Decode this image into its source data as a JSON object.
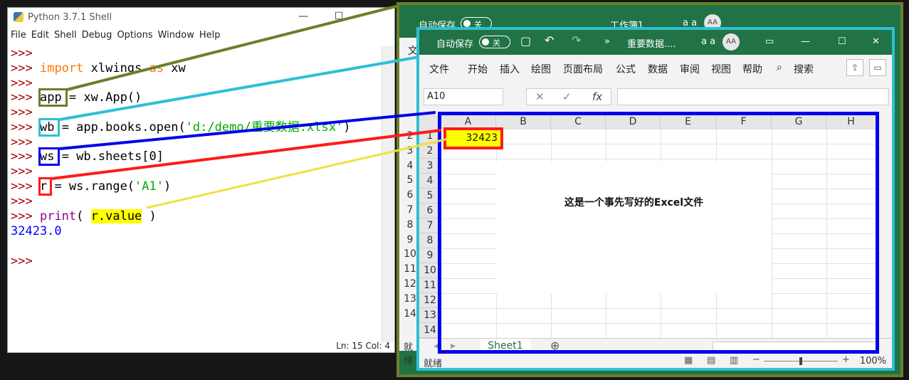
{
  "idle": {
    "title": "Python 3.7.1 Shell",
    "menu": [
      "File",
      "Edit",
      "Shell",
      "Debug",
      "Options",
      "Window",
      "Help"
    ],
    "prompt": ">>>",
    "lines": {
      "l2_kw": "import",
      "l2_rest": " xlwings ",
      "l2_as": "as",
      "l2_alias": " xw",
      "l4_var": "app",
      "l4_rest": " = xw.App()",
      "l6_var": "wb",
      "l6_rest": " = app.books.open(",
      "l6_str": "'d:/demo/重要数据.xlsx'",
      "l6_end": ")",
      "l8_var": "ws",
      "l8_rest": " = wb.sheets[0]",
      "l10_var": "r",
      "l10_rest": " = ws.range(",
      "l10_str": "'A1'",
      "l10_end": ")",
      "l12_fn": "print",
      "l12_open": "( ",
      "l12_arg": "r.value",
      "l12_close": " )",
      "output": "32423.0"
    },
    "status": "Ln: 15  Col: 4",
    "win_min": "—",
    "win_max": "☐"
  },
  "excel_back": {
    "autosave": "自动保存",
    "toggle": "关",
    "title": "工作簿1 ...",
    "font_btn": "a a",
    "avatar": "AA",
    "ribbon_first": "文",
    "status_first": "就绪"
  },
  "excel": {
    "autosave": "自动保存",
    "toggle": "关",
    "title": "重要数据....",
    "font_btn": "a a",
    "avatar": "AA",
    "tabs": [
      "文件",
      "开始",
      "插入",
      "绘图",
      "页面布局",
      "公式",
      "数据",
      "审阅",
      "视图",
      "帮助"
    ],
    "search": "搜索",
    "name_box": "A10",
    "fx": "fx",
    "columns": [
      "A",
      "B",
      "C",
      "D",
      "E",
      "F",
      "G",
      "H"
    ],
    "rows": [
      "1",
      "2",
      "3",
      "4",
      "5",
      "6",
      "7",
      "8",
      "9",
      "10",
      "11",
      "12",
      "13",
      "14"
    ],
    "back_rows": [
      "2",
      "3",
      "4",
      "5",
      "6",
      "7",
      "8",
      "9",
      "10",
      "11",
      "12",
      "13",
      "14"
    ],
    "cell_a1": "32423",
    "note": "这是一个事先写好的Excel文件",
    "sheet": "Sheet1",
    "status": "就绪",
    "zoom": "100%"
  },
  "colors": {
    "excel_green": "#217346",
    "frame_olive": "#6b7f2a",
    "frame_cyan": "#2dc0d4",
    "frame_blue": "#0000ee",
    "frame_red": "#ff1a1a",
    "highlight_yellow": "#ffff00"
  }
}
